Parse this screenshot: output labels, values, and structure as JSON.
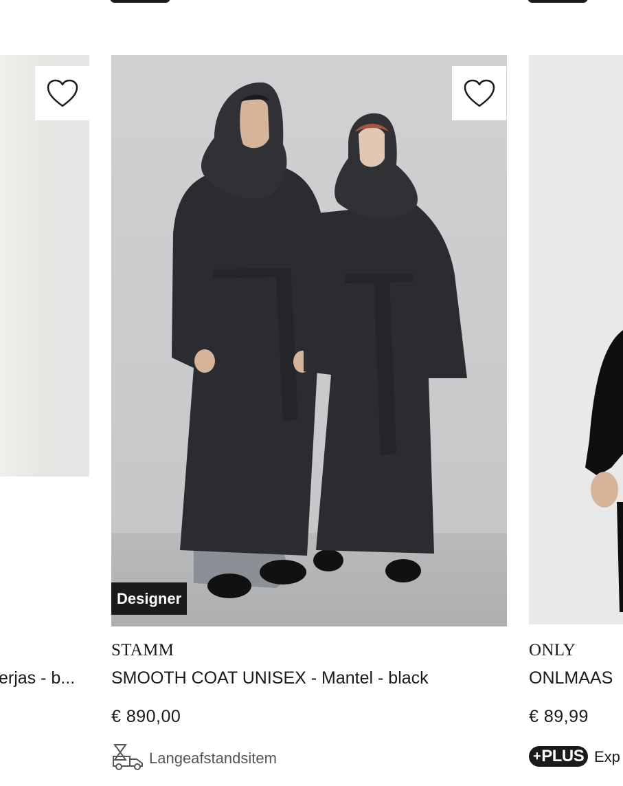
{
  "wishlist_icon": "heart-outline-icon",
  "products": [
    {
      "name": "erjas - b...",
      "has_wishlist": true
    },
    {
      "brand": "STAMM",
      "name": "SMOOTH COAT UNISEX - Mantel - black",
      "price": "€ 890,00",
      "badge": "Designer",
      "shipping_icon": "truck-icon",
      "shipping_label": "Langeafstandsitem"
    },
    {
      "brand": "ONLY",
      "name": "ONLMAAS",
      "price": "€ 89,99",
      "plus_badge": "PLUS",
      "delivery_text": "Exp"
    }
  ],
  "colors": {
    "text": "#1a1a1a",
    "badge_bg": "#1a1a1a",
    "muted": "#555555",
    "coat": "#2a2c30"
  }
}
